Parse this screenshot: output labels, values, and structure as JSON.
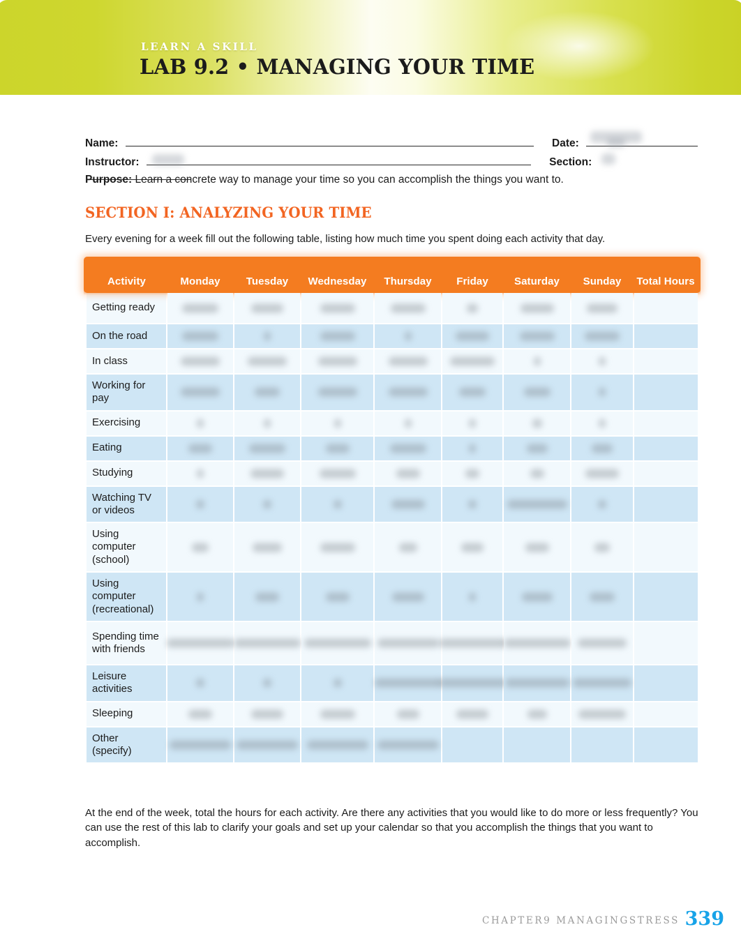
{
  "banner": {
    "eyebrow": "LEARN A SKILL",
    "title": "LAB 9.2 • MANAGING YOUR TIME",
    "accent_left": "#ccd52b",
    "accent_center": "#fdfdf2"
  },
  "form": {
    "name_label": "Name:",
    "date_label": "Date:",
    "instructor_label": "Instructor:",
    "section_label": "Section:",
    "purpose_label": "Purpose:",
    "purpose_text": "Learn a concrete way to manage your time so you can accomplish the things you want to."
  },
  "section": {
    "heading": "SECTION I: ANALYZING YOUR TIME",
    "heading_color": "#f26522",
    "intro": "Every evening for a week fill out the following table, listing how much time you spent doing each activity that day.",
    "outro": "At the end of the week, total the hours for each activity. Are there any activities that you would like to do more or less frequently? You can use the rest of this lab to clarify your goals and set up your calendar so that you accomplish the things that you want to accomplish."
  },
  "table": {
    "header_color": "#f47c20",
    "row_odd_color": "#cfe6f5",
    "row_even_color": "#f2f9fd",
    "columns": [
      "Activity",
      "Monday",
      "Tuesday",
      "Wednesday",
      "Thursday",
      "Friday",
      "Saturday",
      "Sunday",
      "Total Hours"
    ],
    "rows": [
      {
        "activity": "Getting ready",
        "cells": [
          "",
          "",
          "",
          "",
          "",
          "",
          "",
          ""
        ]
      },
      {
        "activity": "On the road",
        "cells": [
          "",
          "",
          "",
          "",
          "",
          "",
          "",
          ""
        ]
      },
      {
        "activity": "In class",
        "cells": [
          "",
          "",
          "",
          "",
          "",
          "",
          "",
          ""
        ]
      },
      {
        "activity": "Working for pay",
        "cells": [
          "",
          "",
          "",
          "",
          "",
          "",
          "",
          ""
        ]
      },
      {
        "activity": "Exercising",
        "cells": [
          "",
          "",
          "",
          "",
          "",
          "",
          "",
          ""
        ]
      },
      {
        "activity": "Eating",
        "cells": [
          "",
          "",
          "",
          "",
          "",
          "",
          "",
          ""
        ]
      },
      {
        "activity": "Studying",
        "cells": [
          "",
          "",
          "",
          "",
          "",
          "",
          "",
          ""
        ]
      },
      {
        "activity": "Watching TV or videos",
        "cells": [
          "",
          "",
          "",
          "",
          "",
          "",
          "",
          ""
        ]
      },
      {
        "activity": "Using computer (school)",
        "cells": [
          "",
          "",
          "",
          "",
          "",
          "",
          "",
          ""
        ]
      },
      {
        "activity": "Using computer (recreational)",
        "cells": [
          "",
          "",
          "",
          "",
          "",
          "",
          "",
          ""
        ]
      },
      {
        "activity": "Spending time with friends",
        "cells": [
          "",
          "",
          "",
          "",
          "",
          "",
          "",
          ""
        ]
      },
      {
        "activity": "Leisure activities",
        "cells": [
          "",
          "",
          "",
          "",
          "",
          "",
          "",
          ""
        ]
      },
      {
        "activity": "Sleeping",
        "cells": [
          "",
          "",
          "",
          "",
          "",
          "",
          "",
          ""
        ]
      },
      {
        "activity": "Other (specify)",
        "cells": [
          "",
          "",
          "",
          "",
          "",
          "",
          "",
          ""
        ]
      }
    ]
  },
  "footer": {
    "chapter_text": "CHAPTER9 MANAGINGSTRESS",
    "page_number": "339",
    "page_number_color": "#17a3e8"
  }
}
